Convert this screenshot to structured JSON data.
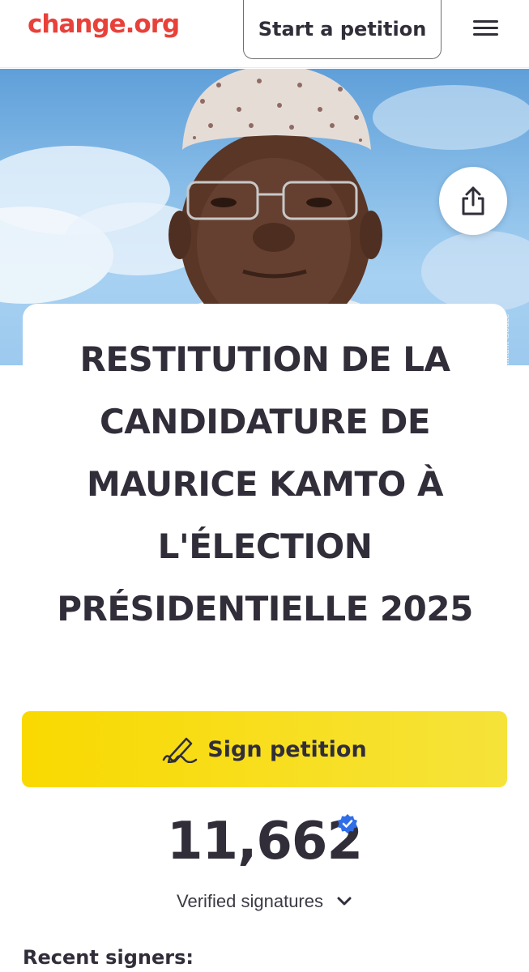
{
  "header": {
    "logo": "change.org",
    "start_petition_label": "Start a petition",
    "menu_icon": "hamburger-menu-icon",
    "logo_color": "#e8413a"
  },
  "hero": {
    "image_description": "portrait-photo",
    "share_icon": "share-icon"
  },
  "petition": {
    "title": "RESTITUTION DE LA CANDIDATURE DE MAURICE KAMTO À L'ÉLECTION PRÉSIDENTIELLE 2025"
  },
  "sign": {
    "label": "Sign petition",
    "icon": "signature-pen-icon",
    "color": "#f9d900"
  },
  "signatures": {
    "count": "11,662",
    "verified_label": "Verified signatures",
    "badge_icon": "verified-badge-icon",
    "badge_color": "#2f6ee8"
  },
  "recent_signers": {
    "heading": "Recent signers:"
  }
}
